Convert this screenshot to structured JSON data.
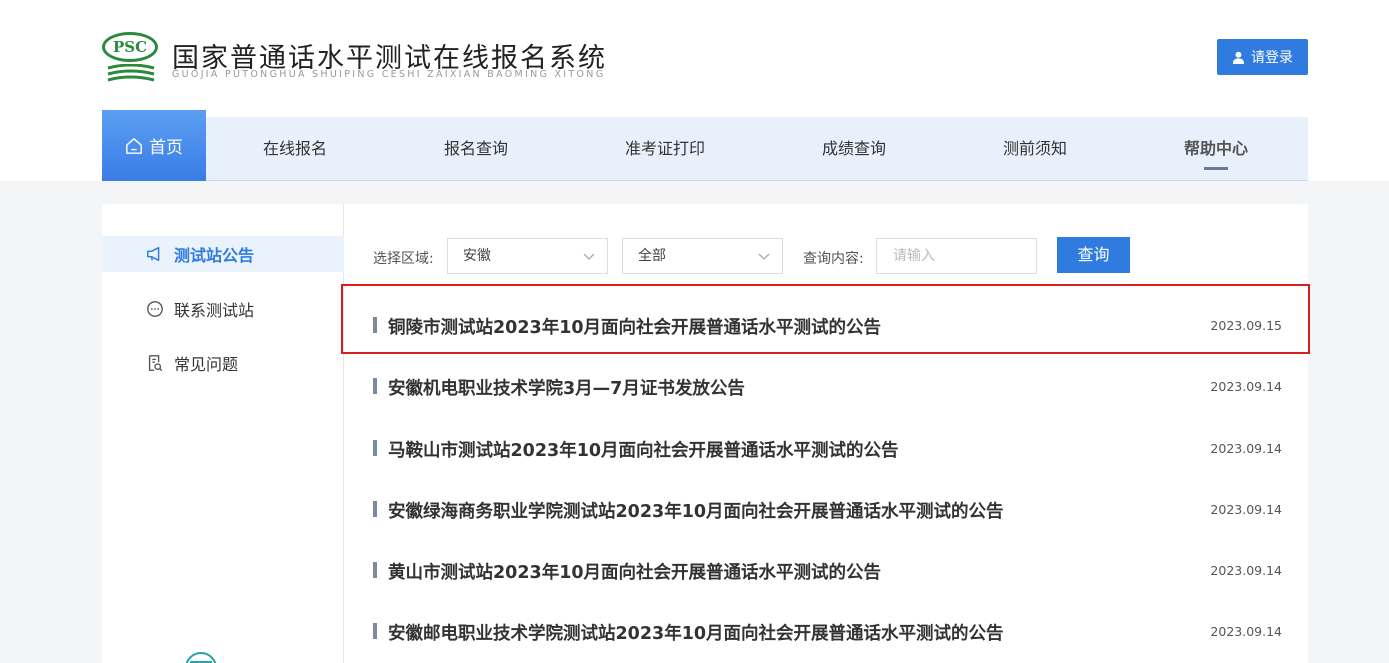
{
  "header": {
    "logo_text": "PSC",
    "title": "国家普通话水平测试在线报名系统",
    "subtitle": "GUOJIA PUTONGHUA SHUIPING CESHI ZAIXIAN BAOMING XITONG",
    "login_label": "请登录"
  },
  "nav": {
    "items": [
      {
        "label": "首页",
        "active": false,
        "home": true
      },
      {
        "label": "在线报名"
      },
      {
        "label": "报名查询"
      },
      {
        "label": "准考证打印"
      },
      {
        "label": "成绩查询"
      },
      {
        "label": "测前须知"
      },
      {
        "label": "帮助中心",
        "active": true
      }
    ]
  },
  "sidebar": {
    "items": [
      {
        "label": "测试站公告",
        "icon": "megaphone-icon",
        "active": true
      },
      {
        "label": "联系测试站",
        "icon": "chat-bubble-icon"
      },
      {
        "label": "常见问题",
        "icon": "document-search-icon"
      }
    ]
  },
  "filter": {
    "region_label": "选择区域:",
    "region_value": "安徽",
    "type_value": "全部",
    "query_label": "查询内容:",
    "query_placeholder": "请输入",
    "query_button": "查询"
  },
  "notices": [
    {
      "title": "铜陵市测试站2023年10月面向社会开展普通话水平测试的公告",
      "date": "2023.09.15",
      "highlighted": true
    },
    {
      "title": "安徽机电职业技术学院3月—7月证书发放公告",
      "date": "2023.09.14"
    },
    {
      "title": "马鞍山市测试站2023年10月面向社会开展普通话水平测试的公告",
      "date": "2023.09.14"
    },
    {
      "title": "安徽绿海商务职业学院测试站2023年10月面向社会开展普通话水平测试的公告",
      "date": "2023.09.14"
    },
    {
      "title": "黄山市测试站2023年10月面向社会开展普通话水平测试的公告",
      "date": "2023.09.14"
    },
    {
      "title": "安徽邮电职业技术学院测试站2023年10月面向社会开展普通话水平测试的公告",
      "date": "2023.09.14"
    }
  ],
  "colors": {
    "primary": "#2f7be0",
    "logo_green": "#2a8a3a",
    "highlight_red": "#d42020"
  }
}
